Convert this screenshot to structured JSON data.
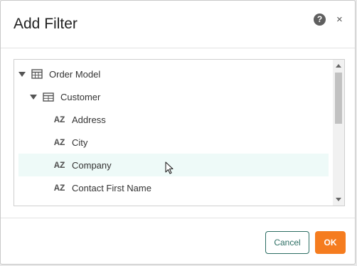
{
  "dialog": {
    "title": "Add Filter",
    "help_icon": "?",
    "close_icon": "×"
  },
  "tree": {
    "items": [
      {
        "label": "Order Model",
        "icon": "model-grid-icon",
        "expanded": true
      },
      {
        "label": "Customer",
        "icon": "table-icon",
        "expanded": true
      },
      {
        "label": "Address",
        "icon": "text-field-icon",
        "type_badge": "AZ"
      },
      {
        "label": "City",
        "icon": "text-field-icon",
        "type_badge": "AZ"
      },
      {
        "label": "Company",
        "icon": "text-field-icon",
        "type_badge": "AZ",
        "hovered": true
      },
      {
        "label": "Contact First Name",
        "icon": "text-field-icon",
        "type_badge": "AZ"
      }
    ]
  },
  "footer": {
    "cancel_label": "Cancel",
    "ok_label": "OK"
  },
  "colors": {
    "accent_orange": "#f57c1f",
    "cancel_border": "#2c6e63",
    "hover_row": "#eefaf8"
  }
}
